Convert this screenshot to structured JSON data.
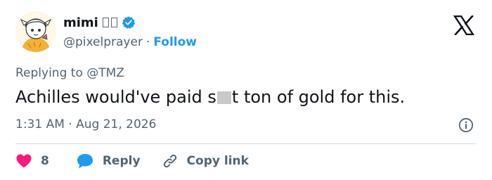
{
  "author": {
    "display_name": "mimi",
    "handle": "@pixelprayer",
    "separator": "·",
    "follow_label": "Follow",
    "verified": true,
    "verified_color": "#1d9bf0"
  },
  "reply_context": {
    "prefix": "Replying to",
    "mention": "@TMZ"
  },
  "tweet": {
    "text_before": "Achilles would've paid s",
    "text_after": "t ton of gold for this.",
    "time": "1:31 AM",
    "date_separator": "·",
    "date": "Aug 21, 2026"
  },
  "actions": {
    "like_count": "8",
    "like_color": "#f91880",
    "reply_label": "Reply",
    "reply_color": "#1d9bf0",
    "copy_link_label": "Copy link"
  },
  "icons": {
    "brand": "x-logo-icon",
    "verified": "verified-badge-icon",
    "info": "info-icon",
    "like": "heart-icon",
    "reply": "reply-bubble-icon",
    "copy_link": "link-icon"
  }
}
